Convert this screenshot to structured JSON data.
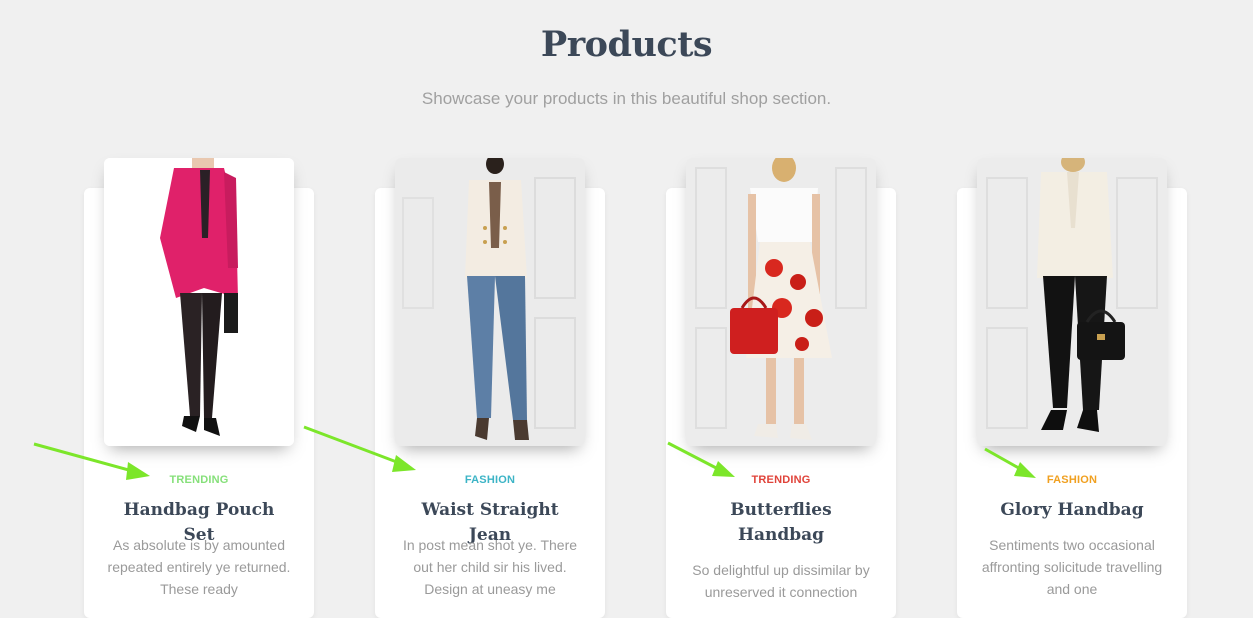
{
  "section": {
    "title": "Products",
    "subtitle": "Showcase your products in this beautiful shop section."
  },
  "colors": {
    "trending_green": "#86e07a",
    "fashion_blue": "#3cb4c6",
    "trending_red": "#e0433a",
    "fashion_orange": "#f0a020",
    "annotation_arrow": "#7ce62a"
  },
  "products": [
    {
      "category": "TRENDING",
      "title": "Handbag Pouch Set",
      "description": "As absolute is by amounted repeated entirely ye returned. These ready"
    },
    {
      "category": "FASHION",
      "title": "Waist Straight Jean",
      "description": "In post mean shot ye. There out her child sir his lived. Design at uneasy me"
    },
    {
      "category": "TRENDING",
      "title": "Butterflies Handbag",
      "description": "So delightful up dissimilar by unreserved it connection"
    },
    {
      "category": "FASHION",
      "title": "Glory Handbag",
      "description": "Sentiments two occasional affronting solicitude travelling and one"
    }
  ]
}
